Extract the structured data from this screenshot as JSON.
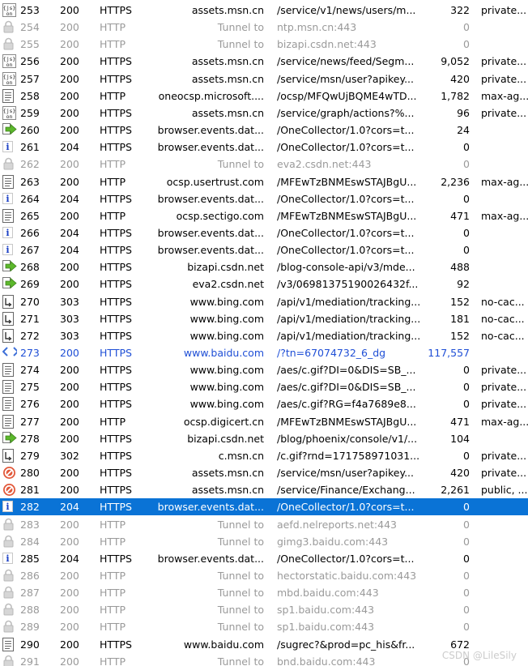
{
  "sessions": [
    {
      "icon": "json-icon",
      "num": "253",
      "result": "200",
      "protocol": "HTTPS",
      "host": "assets.msn.cn",
      "url": "/service/v1/news/users/m...",
      "body": "322",
      "caching": "private...",
      "state": ""
    },
    {
      "icon": "lock-icon",
      "num": "254",
      "result": "200",
      "protocol": "HTTP",
      "host": "Tunnel to",
      "url": "ntp.msn.cn:443",
      "body": "0",
      "caching": "",
      "state": "dim"
    },
    {
      "icon": "lock-icon",
      "num": "255",
      "result": "200",
      "protocol": "HTTP",
      "host": "Tunnel to",
      "url": "bizapi.csdn.net:443",
      "body": "0",
      "caching": "",
      "state": "dim"
    },
    {
      "icon": "json-icon",
      "num": "256",
      "result": "200",
      "protocol": "HTTPS",
      "host": "assets.msn.cn",
      "url": "/service/news/feed/Segm...",
      "body": "9,052",
      "caching": "private...",
      "state": ""
    },
    {
      "icon": "json-icon",
      "num": "257",
      "result": "200",
      "protocol": "HTTPS",
      "host": "assets.msn.cn",
      "url": "/service/msn/user?apikey...",
      "body": "420",
      "caching": "private...",
      "state": ""
    },
    {
      "icon": "document-icon",
      "num": "258",
      "result": "200",
      "protocol": "HTTP",
      "host": "oneocsp.microsoft....",
      "url": "/ocsp/MFQwUjBQME4wTD...",
      "body": "1,782",
      "caching": "max-ag...",
      "state": ""
    },
    {
      "icon": "json-icon",
      "num": "259",
      "result": "200",
      "protocol": "HTTPS",
      "host": "assets.msn.cn",
      "url": "/service/graph/actions?%...",
      "body": "96",
      "caching": "private...",
      "state": ""
    },
    {
      "icon": "post-arrow-icon",
      "num": "260",
      "result": "200",
      "protocol": "HTTPS",
      "host": "browser.events.dat...",
      "url": "/OneCollector/1.0?cors=t...",
      "body": "24",
      "caching": "",
      "state": ""
    },
    {
      "icon": "info-icon",
      "num": "261",
      "result": "204",
      "protocol": "HTTPS",
      "host": "browser.events.dat...",
      "url": "/OneCollector/1.0?cors=t...",
      "body": "0",
      "caching": "",
      "state": ""
    },
    {
      "icon": "lock-icon",
      "num": "262",
      "result": "200",
      "protocol": "HTTP",
      "host": "Tunnel to",
      "url": "eva2.csdn.net:443",
      "body": "0",
      "caching": "",
      "state": "dim"
    },
    {
      "icon": "document-icon",
      "num": "263",
      "result": "200",
      "protocol": "HTTP",
      "host": "ocsp.usertrust.com",
      "url": "/MFEwTzBNMEswSTAJBgU...",
      "body": "2,236",
      "caching": "max-ag...",
      "state": ""
    },
    {
      "icon": "info-icon",
      "num": "264",
      "result": "204",
      "protocol": "HTTPS",
      "host": "browser.events.dat...",
      "url": "/OneCollector/1.0?cors=t...",
      "body": "0",
      "caching": "",
      "state": ""
    },
    {
      "icon": "document-icon",
      "num": "265",
      "result": "200",
      "protocol": "HTTP",
      "host": "ocsp.sectigo.com",
      "url": "/MFEwTzBNMEswSTAJBgU...",
      "body": "471",
      "caching": "max-ag...",
      "state": ""
    },
    {
      "icon": "info-icon",
      "num": "266",
      "result": "204",
      "protocol": "HTTPS",
      "host": "browser.events.dat...",
      "url": "/OneCollector/1.0?cors=t...",
      "body": "0",
      "caching": "",
      "state": ""
    },
    {
      "icon": "info-icon",
      "num": "267",
      "result": "204",
      "protocol": "HTTPS",
      "host": "browser.events.dat...",
      "url": "/OneCollector/1.0?cors=t...",
      "body": "0",
      "caching": "",
      "state": ""
    },
    {
      "icon": "post-arrow-icon",
      "num": "268",
      "result": "200",
      "protocol": "HTTPS",
      "host": "bizapi.csdn.net",
      "url": "/blog-console-api/v3/mde...",
      "body": "488",
      "caching": "",
      "state": ""
    },
    {
      "icon": "post-arrow-icon",
      "num": "269",
      "result": "200",
      "protocol": "HTTPS",
      "host": "eva2.csdn.net",
      "url": "/v3/06981375190026432f...",
      "body": "92",
      "caching": "",
      "state": ""
    },
    {
      "icon": "redirect-icon",
      "num": "270",
      "result": "303",
      "protocol": "HTTPS",
      "host": "www.bing.com",
      "url": "/api/v1/mediation/tracking...",
      "body": "152",
      "caching": "no-cac...",
      "state": ""
    },
    {
      "icon": "redirect-icon",
      "num": "271",
      "result": "303",
      "protocol": "HTTPS",
      "host": "www.bing.com",
      "url": "/api/v1/mediation/tracking...",
      "body": "181",
      "caching": "no-cac...",
      "state": ""
    },
    {
      "icon": "redirect-icon",
      "num": "272",
      "result": "303",
      "protocol": "HTTPS",
      "host": "www.bing.com",
      "url": "/api/v1/mediation/tracking...",
      "body": "152",
      "caching": "no-cac...",
      "state": ""
    },
    {
      "icon": "html-icon",
      "num": "273",
      "result": "200",
      "protocol": "HTTPS",
      "host": "www.baidu.com",
      "url": "/?tn=67074732_6_dg",
      "body": "117,557",
      "caching": "",
      "state": "link"
    },
    {
      "icon": "document-icon",
      "num": "274",
      "result": "200",
      "protocol": "HTTPS",
      "host": "www.bing.com",
      "url": "/aes/c.gif?DI=0&DIS=SB_...",
      "body": "0",
      "caching": "private...",
      "state": ""
    },
    {
      "icon": "document-icon",
      "num": "275",
      "result": "200",
      "protocol": "HTTPS",
      "host": "www.bing.com",
      "url": "/aes/c.gif?DI=0&DIS=SB_...",
      "body": "0",
      "caching": "private...",
      "state": ""
    },
    {
      "icon": "document-icon",
      "num": "276",
      "result": "200",
      "protocol": "HTTPS",
      "host": "www.bing.com",
      "url": "/aes/c.gif?RG=f4a7689e8...",
      "body": "0",
      "caching": "private...",
      "state": ""
    },
    {
      "icon": "document-icon",
      "num": "277",
      "result": "200",
      "protocol": "HTTP",
      "host": "ocsp.digicert.cn",
      "url": "/MFEwTzBNMEswSTAJBgU...",
      "body": "471",
      "caching": "max-ag...",
      "state": ""
    },
    {
      "icon": "post-arrow-icon",
      "num": "278",
      "result": "200",
      "protocol": "HTTPS",
      "host": "bizapi.csdn.net",
      "url": "/blog/phoenix/console/v1/...",
      "body": "104",
      "caching": "",
      "state": ""
    },
    {
      "icon": "redirect-icon",
      "num": "279",
      "result": "302",
      "protocol": "HTTPS",
      "host": "c.msn.cn",
      "url": "/c.gif?rnd=171758971031...",
      "body": "0",
      "caching": "private...",
      "state": ""
    },
    {
      "icon": "blocked-icon",
      "num": "280",
      "result": "200",
      "protocol": "HTTPS",
      "host": "assets.msn.cn",
      "url": "/service/msn/user?apikey...",
      "body": "420",
      "caching": "private...",
      "state": ""
    },
    {
      "icon": "blocked-icon",
      "num": "281",
      "result": "200",
      "protocol": "HTTPS",
      "host": "assets.msn.cn",
      "url": "/service/Finance/Exchang...",
      "body": "2,261",
      "caching": "public, ...",
      "state": ""
    },
    {
      "icon": "info-icon",
      "num": "282",
      "result": "204",
      "protocol": "HTTPS",
      "host": "browser.events.dat...",
      "url": "/OneCollector/1.0?cors=t...",
      "body": "0",
      "caching": "",
      "state": "selected"
    },
    {
      "icon": "lock-icon",
      "num": "283",
      "result": "200",
      "protocol": "HTTP",
      "host": "Tunnel to",
      "url": "aefd.nelreports.net:443",
      "body": "0",
      "caching": "",
      "state": "dim"
    },
    {
      "icon": "lock-icon",
      "num": "284",
      "result": "200",
      "protocol": "HTTP",
      "host": "Tunnel to",
      "url": "gimg3.baidu.com:443",
      "body": "0",
      "caching": "",
      "state": "dim"
    },
    {
      "icon": "info-icon",
      "num": "285",
      "result": "204",
      "protocol": "HTTPS",
      "host": "browser.events.dat...",
      "url": "/OneCollector/1.0?cors=t...",
      "body": "0",
      "caching": "",
      "state": ""
    },
    {
      "icon": "lock-icon",
      "num": "286",
      "result": "200",
      "protocol": "HTTP",
      "host": "Tunnel to",
      "url": "hectorstatic.baidu.com:443",
      "body": "0",
      "caching": "",
      "state": "dim"
    },
    {
      "icon": "lock-icon",
      "num": "287",
      "result": "200",
      "protocol": "HTTP",
      "host": "Tunnel to",
      "url": "mbd.baidu.com:443",
      "body": "0",
      "caching": "",
      "state": "dim"
    },
    {
      "icon": "lock-icon",
      "num": "288",
      "result": "200",
      "protocol": "HTTP",
      "host": "Tunnel to",
      "url": "sp1.baidu.com:443",
      "body": "0",
      "caching": "",
      "state": "dim"
    },
    {
      "icon": "lock-icon",
      "num": "289",
      "result": "200",
      "protocol": "HTTP",
      "host": "Tunnel to",
      "url": "sp1.baidu.com:443",
      "body": "0",
      "caching": "",
      "state": "dim"
    },
    {
      "icon": "document-icon",
      "num": "290",
      "result": "200",
      "protocol": "HTTPS",
      "host": "www.baidu.com",
      "url": "/sugrec?&prod=pc_his&fr...",
      "body": "672",
      "caching": "",
      "state": ""
    },
    {
      "icon": "lock-icon",
      "num": "291",
      "result": "200",
      "protocol": "HTTP",
      "host": "Tunnel to",
      "url": "bnd.baidu.com:443",
      "body": "0",
      "caching": "",
      "state": "dim"
    }
  ],
  "watermark": "CSDN @LileSily",
  "colors": {
    "selection": "#0a73d6",
    "dim_text": "#9a9a9a",
    "link_text": "#1f4fd6"
  }
}
